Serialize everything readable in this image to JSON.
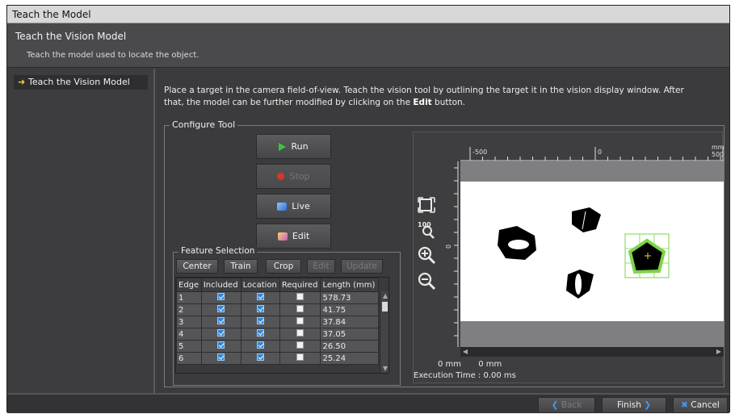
{
  "window": {
    "title": "Teach the Model"
  },
  "header": {
    "title": "Teach the Vision Model",
    "subtitle": "Teach the model used to locate the object."
  },
  "sidebar": {
    "items": [
      {
        "label": "Teach the Vision Model"
      }
    ]
  },
  "main": {
    "instructions_line1": "Place a target in the camera field-of-view. Teach the vision tool by outlining the target it in the vision display window. After",
    "instructions_line2_pre": "that, the model can be further modified by clicking on the ",
    "instructions_bold": "Edit",
    "instructions_line2_post": " button."
  },
  "configure_tool": {
    "legend": "Configure Tool",
    "buttons": {
      "run": "Run",
      "stop": "Stop",
      "live": "Live",
      "edit": "Edit"
    }
  },
  "feature_selection": {
    "legend": "Feature Selection",
    "buttons": {
      "center": "Center",
      "train": "Train",
      "crop": "Crop",
      "edit": "Edit",
      "update": "Update"
    },
    "columns": [
      "Edge",
      "Included",
      "Location",
      "Required",
      "Length (mm)"
    ],
    "rows": [
      {
        "edge": "1",
        "included": true,
        "location": true,
        "required": false,
        "length": "578.73"
      },
      {
        "edge": "2",
        "included": true,
        "location": true,
        "required": false,
        "length": "41.75"
      },
      {
        "edge": "3",
        "included": true,
        "location": true,
        "required": false,
        "length": "37.84"
      },
      {
        "edge": "4",
        "included": true,
        "location": true,
        "required": false,
        "length": "37.05"
      },
      {
        "edge": "5",
        "included": true,
        "location": true,
        "required": false,
        "length": "26.50"
      },
      {
        "edge": "6",
        "included": true,
        "location": true,
        "required": false,
        "length": "25.24"
      }
    ]
  },
  "vision_display": {
    "ruler": {
      "unit": "mm",
      "top_labels": [
        "-500",
        "0",
        "500"
      ],
      "left_label": "0"
    },
    "coords": {
      "x": "0 mm",
      "y": "0 mm"
    },
    "execution_time": "Execution Time : 0.00 ms",
    "tools": [
      "fit-view-icon",
      "zoom-100-icon",
      "zoom-in-icon",
      "zoom-out-icon"
    ]
  },
  "footer": {
    "back": "Back",
    "finish": "Finish",
    "cancel": "Cancel"
  },
  "colors": {
    "frame_bg": "#3b3b3d",
    "model_green": "#7ed348",
    "run_green": "#3cc63c",
    "stop_red": "#e0322c",
    "accent_blue": "#3a9bff"
  }
}
